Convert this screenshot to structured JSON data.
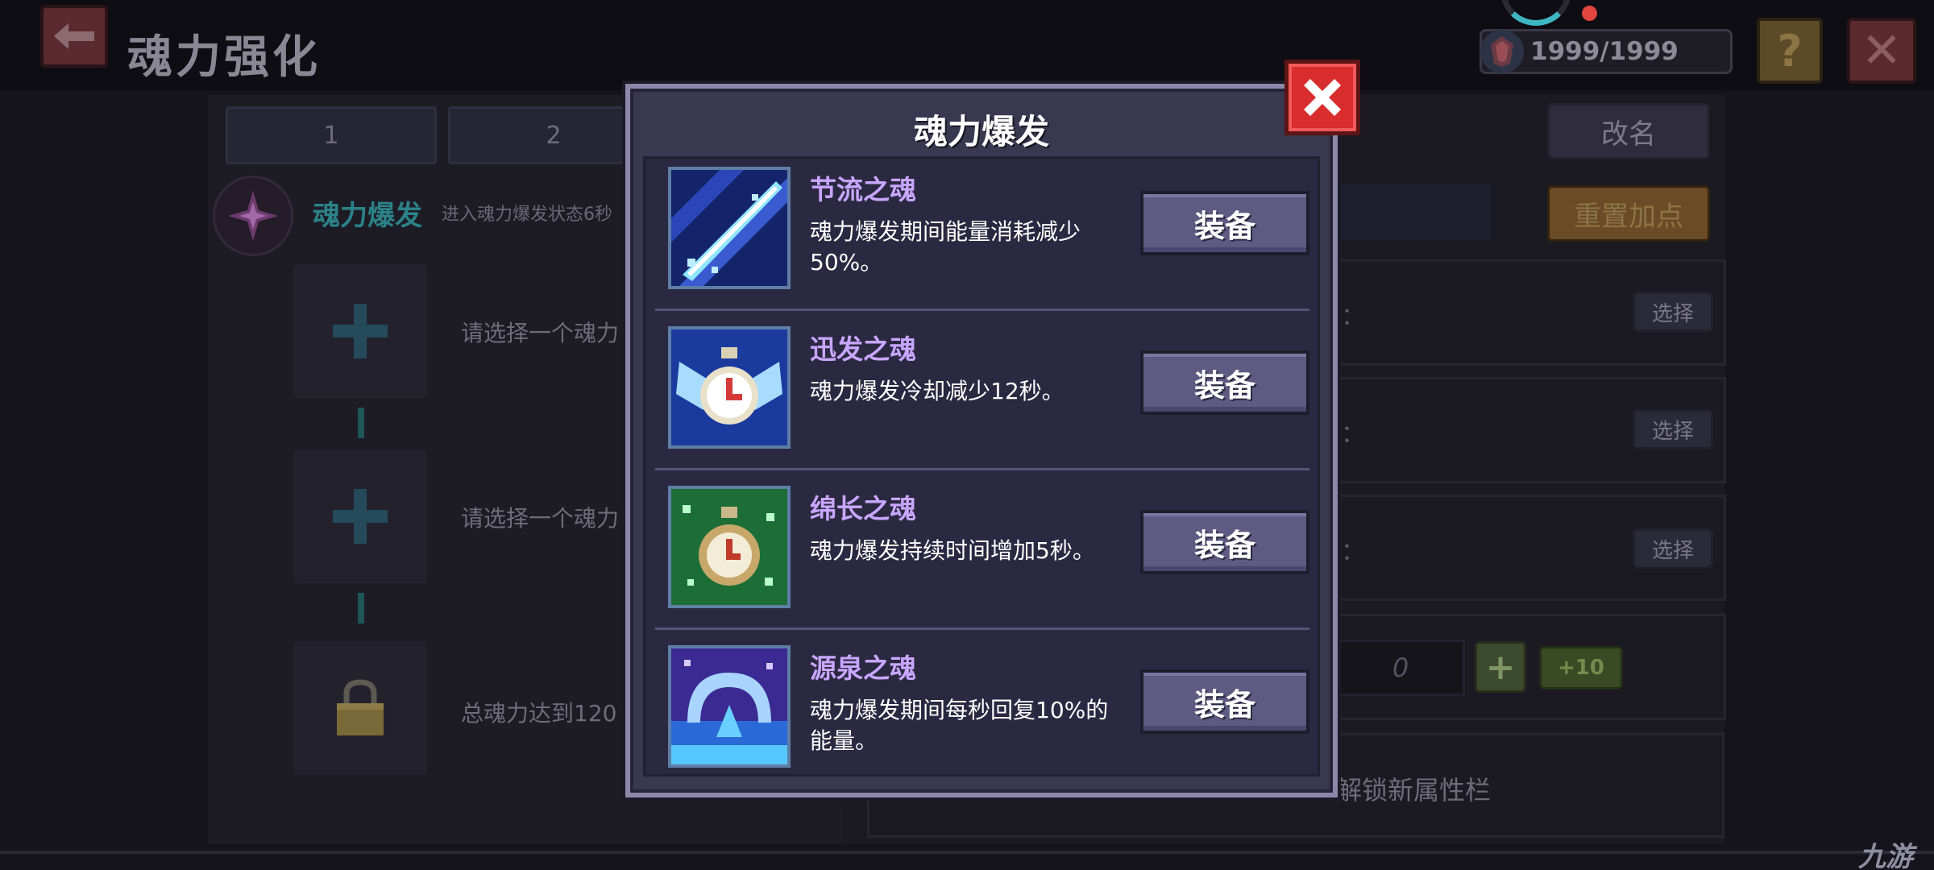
{
  "header": {
    "title": "魂力强化",
    "currency": "1999/1999",
    "help_label": "?",
    "close_label": "✕"
  },
  "background": {
    "tabs": [
      "1",
      "2"
    ],
    "rename_label": "改名",
    "reset_label": "重置加点",
    "burst_label": "魂力爆发",
    "burst_desc": "进入魂力爆发状态6秒",
    "slot_texts": [
      "请选择一个魂力",
      "请选择一个魂力",
      "总魂力达到120"
    ],
    "row_colon": "：",
    "select_label": "选择",
    "point_value": "0",
    "plus_label": "+",
    "plus10_label": "+10",
    "unlock_text": "解锁新属性栏",
    "watermark": "九游"
  },
  "modal": {
    "title": "魂力爆发",
    "close_label": "✕",
    "equip_label": "装备",
    "skills": [
      {
        "name": "节流之魂",
        "desc": "魂力爆发期间能量消耗减少50%。",
        "icon": "sword-slash-icon",
        "color": "#1a3fa8"
      },
      {
        "name": "迅发之魂",
        "desc": "魂力爆发冷却减少12秒。",
        "icon": "winged-stopwatch-icon",
        "color": "#1c3fa6"
      },
      {
        "name": "绵长之魂",
        "desc": "魂力爆发持续时间增加5秒。",
        "icon": "green-stopwatch-icon",
        "color": "#1f7a3c"
      },
      {
        "name": "源泉之魂",
        "desc": "魂力爆发期间每秒回复10%的能量。",
        "icon": "fountain-icon",
        "color": "#4a3aa8"
      }
    ]
  },
  "colors": {
    "modal_bg": "#3a3750",
    "skill_name": "#c9a6ff",
    "equip_button": "#5e5a82",
    "close_red": "#d92c2c"
  }
}
